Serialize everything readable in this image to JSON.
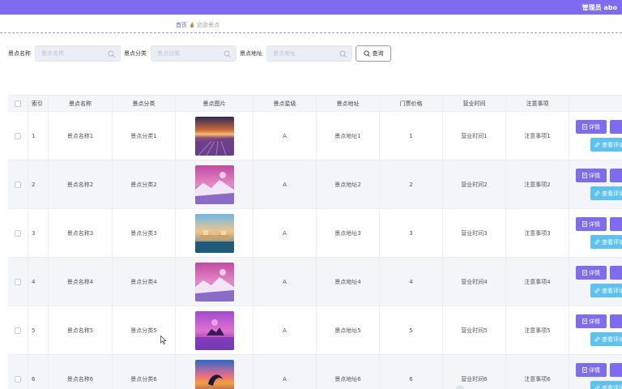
{
  "header": {
    "user_label": "管理员 abo"
  },
  "breadcrumb": {
    "home": "首页",
    "current": "旅游景点"
  },
  "search": {
    "name_label": "景点名称",
    "name_placeholder": "景点名称",
    "category_label": "景点分类",
    "category_placeholder": "景点分类",
    "address_label": "景点地址",
    "address_placeholder": "景点地址",
    "query_label": "查询"
  },
  "table": {
    "columns": [
      "索引",
      "景点名称",
      "景点分类",
      "景点图片",
      "景点星级",
      "景点地址",
      "门票价格",
      "营业时间",
      "注意事项",
      ""
    ],
    "rows": [
      {
        "index": "1",
        "name": "景点名称1",
        "category": "景点分类1",
        "image": "lavender-sunset-photo",
        "stars": "A",
        "address": "景点地址1",
        "price": "1",
        "hours": "营业时间1",
        "notes": "注意事项1"
      },
      {
        "index": "2",
        "name": "景点名称2",
        "category": "景点分类2",
        "image": "purple-snow-mountain-photo",
        "stars": "A",
        "address": "景点地址2",
        "price": "2",
        "hours": "营业时间2",
        "notes": "注意事项2"
      },
      {
        "index": "3",
        "name": "景点名称3",
        "category": "景点分类3",
        "image": "harbor-town-photo",
        "stars": "A",
        "address": "景点地址3",
        "price": "3",
        "hours": "营业时间3",
        "notes": "注意事项3"
      },
      {
        "index": "4",
        "name": "景点名称4",
        "category": "景点分类4",
        "image": "purple-snow-mountain-photo",
        "stars": "A",
        "address": "景点地址4",
        "price": "4",
        "hours": "营业时间4",
        "notes": "注意事项4"
      },
      {
        "index": "5",
        "name": "景点名称5",
        "category": "景点分类5",
        "image": "purple-sea-rocks-photo",
        "stars": "A",
        "address": "景点地址5",
        "price": "5",
        "hours": "营业时间5",
        "notes": "注意事项5"
      },
      {
        "index": "6",
        "name": "景点名称6",
        "category": "景点分类6",
        "image": "dolphin-sunset-photo",
        "stars": "A",
        "address": "景点地址6",
        "price": "6",
        "hours": "营业时间6",
        "notes": "注意事项6"
      }
    ],
    "actions": {
      "detail": "详情",
      "reviews": "查看评论"
    }
  },
  "colors": {
    "primary": "#7d6cf0",
    "secondary": "#5ec2f0"
  }
}
